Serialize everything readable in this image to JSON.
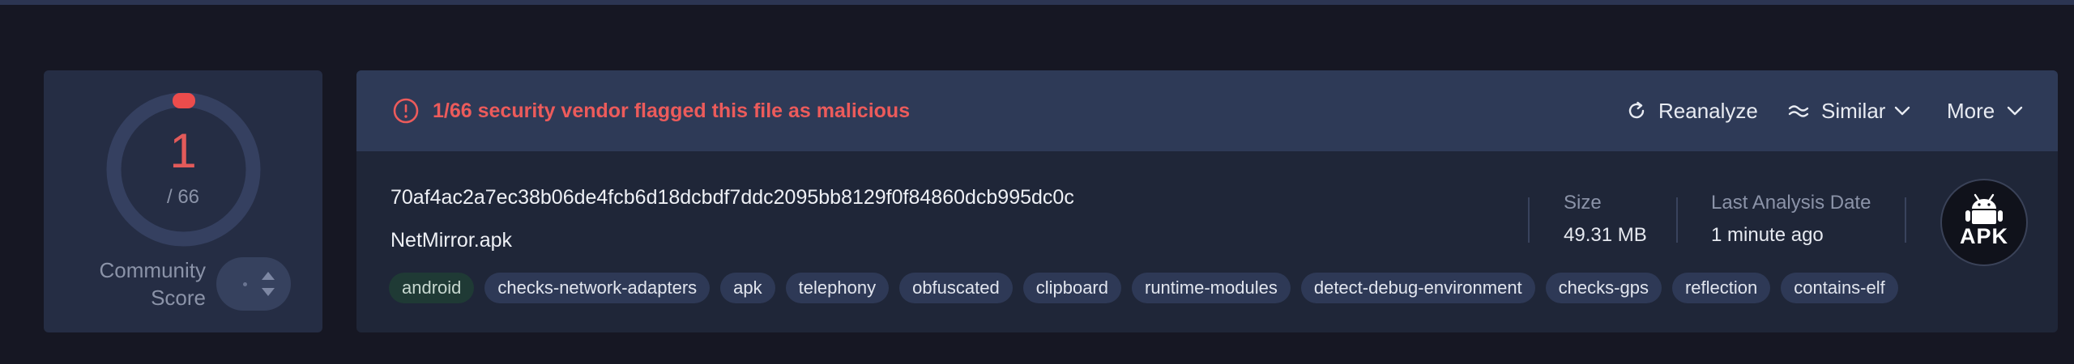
{
  "score": {
    "value": "1",
    "total": "/ 66",
    "label_line1": "Community",
    "label_line2": "Score",
    "accent_color": "#e35a5a",
    "malicious_fraction": 0.015
  },
  "alert": {
    "icon": "exclamation-circle-icon",
    "text": "1/66 security vendor flagged this file as malicious",
    "color": "#ec5b5b"
  },
  "actions": {
    "reanalyze": "Reanalyze",
    "similar": "Similar",
    "more": "More"
  },
  "file": {
    "hash": "70af4ac2a7ec38b06de4fcb6d18dcbdf7ddc2095bb8129f0f84860dcb995dc0c",
    "name": "NetMirror.apk",
    "tags": [
      "android",
      "checks-network-adapters",
      "apk",
      "telephony",
      "obfuscated",
      "clipboard",
      "runtime-modules",
      "detect-debug-environment",
      "checks-gps",
      "reflection",
      "contains-elf"
    ]
  },
  "meta": {
    "size_label": "Size",
    "size_value": "49.31 MB",
    "date_label": "Last Analysis Date",
    "date_value": "1 minute ago"
  },
  "file_type": {
    "icon": "android-icon",
    "label": "APK"
  }
}
